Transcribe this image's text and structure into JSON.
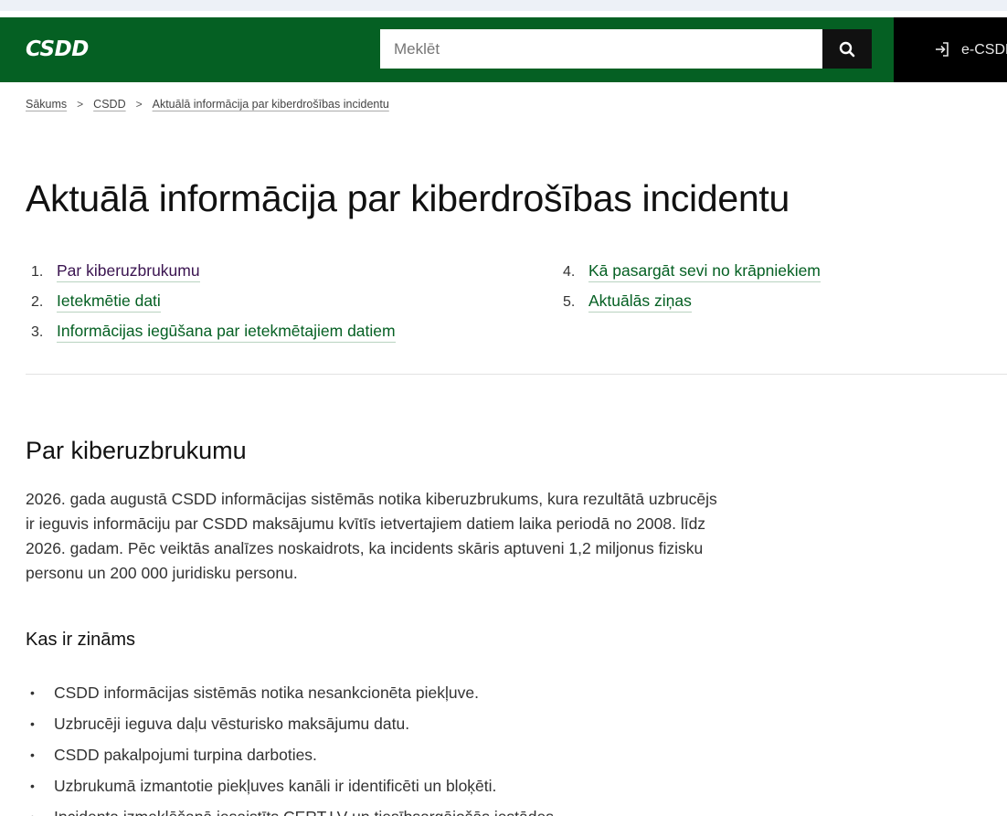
{
  "header": {
    "logo": "CSDD",
    "search_placeholder": "Meklēt",
    "ecsdd_label": "e-CSDD"
  },
  "breadcrumb": {
    "items": [
      "Sākums",
      "CSDD"
    ],
    "separator": ">",
    "current": "Aktuālā informācija par kiberdrošības incidentu"
  },
  "page_title": "Aktuālā informācija par kiberdrošības incidentu",
  "toc": [
    {
      "num": "1.",
      "label": "Par kiberuzbrukumu",
      "visited": true
    },
    {
      "num": "2.",
      "label": "Ietekmētie dati",
      "visited": false
    },
    {
      "num": "3.",
      "label": "Informācijas iegūšana par ietekmētajiem datiem",
      "visited": false
    },
    {
      "num": "4.",
      "label": "Kā pasargāt sevi no krāpniekiem",
      "visited": false
    },
    {
      "num": "5.",
      "label": "Aktuālās ziņas",
      "visited": false
    }
  ],
  "section": {
    "title": "Par kiberuzbrukumu",
    "intro": "2026. gada augustā CSDD informācijas sistēmās notika kiberuzbrukums, kura rezultātā uzbrucējs ir ieguvis informāciju par CSDD maksājumu kvītīs ietvertajiem datiem laika periodā no 2008. līdz 2026. gadam. Pēc veiktās analīzes noskaidrots, ka incidents skāris aptuveni 1,2 miljonus fizisku personu un 200 000 juridisku personu.",
    "subtitle": "Kas ir zināms",
    "bullets": [
      "CSDD informācijas sistēmās notika nesankcionēta piekļuve.",
      "Uzbrucēji ieguva daļu vēsturisko maksājumu datu.",
      "CSDD pakalpojumi turpina darboties.",
      "Uzbrukumā izmantotie piekļuves kanāli ir identificēti un bloķēti.",
      "Incidenta izmeklēšanā iesaistīts CERT.LV un tiesībsargājošās iestādes."
    ]
  },
  "colors": {
    "brand_green": "#056023",
    "link_green": "#056023",
    "visited_link": "#3a1450"
  }
}
